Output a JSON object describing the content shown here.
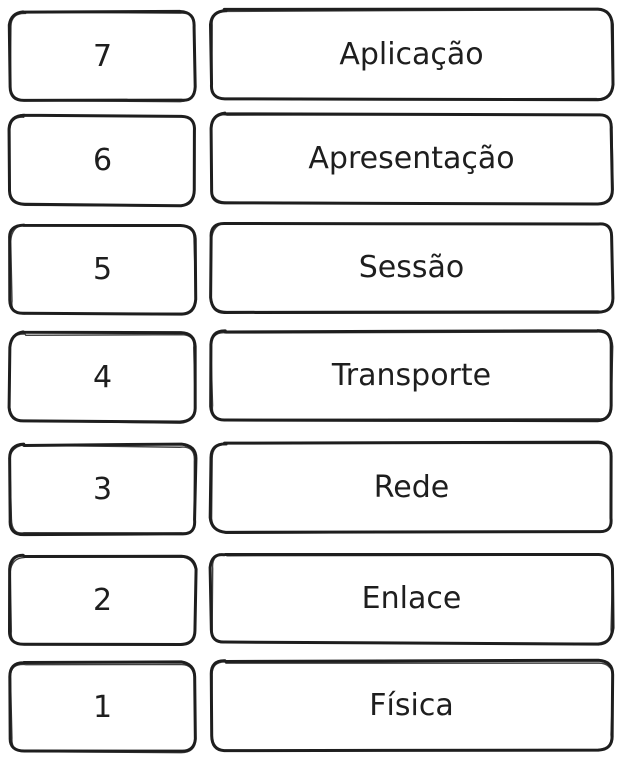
{
  "diagram": {
    "colors": {
      "stroke": "#1e1e1e",
      "fill": "#ffffff",
      "text": "#1e1e1e"
    },
    "layers": [
      {
        "number": "7",
        "name": "Aplicação"
      },
      {
        "number": "6",
        "name": "Apresentação"
      },
      {
        "number": "5",
        "name": "Sessão"
      },
      {
        "number": "4",
        "name": "Transporte"
      },
      {
        "number": "3",
        "name": "Rede"
      },
      {
        "number": "2",
        "name": "Enlace"
      },
      {
        "number": "1",
        "name": "Física"
      }
    ]
  }
}
